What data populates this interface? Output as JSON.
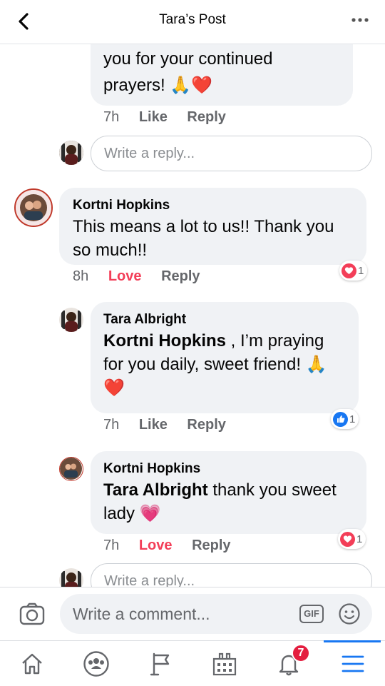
{
  "header": {
    "title": "Tara’s Post"
  },
  "top_comment": {
    "text_line1": "you for your continued",
    "text_line2": "prayers! 🙏❤️",
    "time": "7h",
    "like": "Like",
    "reply": "Reply"
  },
  "reply_input_1": {
    "placeholder": "Write a reply..."
  },
  "comment_kortni": {
    "name": "Kortni Hopkins",
    "text": "This means a lot to us!! Thank you so much!!",
    "time": "8h",
    "reaction_label": "Love",
    "reply": "Reply",
    "reaction_count": "1"
  },
  "reply_tara": {
    "name": "Tara Albright",
    "mention": "Kortni Hopkins",
    "text": " , I’m praying for you daily, sweet friend! 🙏 ❤️",
    "time": "7h",
    "like": "Like",
    "reply": "Reply",
    "reaction_count": "1"
  },
  "reply_kortni": {
    "name": "Kortni Hopkins",
    "mention": "Tara Albright",
    "text": " thank you sweet lady 💗",
    "time": "7h",
    "reaction_label": "Love",
    "reply": "Reply",
    "reaction_count": "1"
  },
  "reply_input_2": {
    "placeholder": "Write a reply..."
  },
  "composer": {
    "placeholder": "Write a comment...",
    "gif": "GIF"
  },
  "tabbar": {
    "notifications_badge": "7"
  },
  "colors": {
    "accent": "#1877f2",
    "love": "#f33e58",
    "badge": "#e41e3f"
  }
}
